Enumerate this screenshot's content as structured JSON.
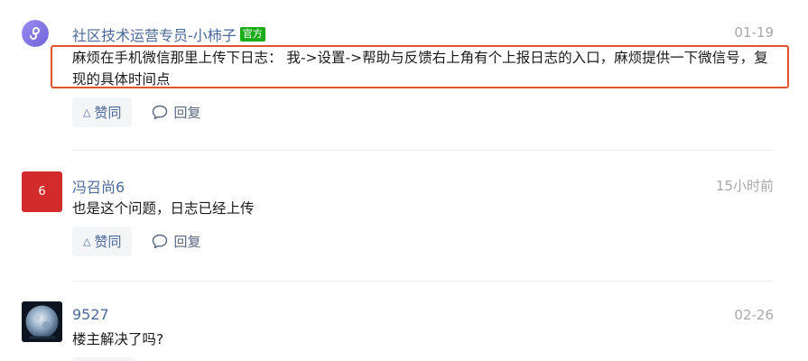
{
  "comments": [
    {
      "author": "社区技术运营专员-小柿子",
      "badge": "官方",
      "time": "01-19",
      "content": "麻烦在手机微信那里上传下日志： 我->设置->帮助与反馈右上角有个上报日志的入口，麻烦提供一下微信号，复现的具体时间点",
      "like_label": "赞同",
      "reply_label": "回复",
      "avatar_icon": "mini-program-icon"
    },
    {
      "author": "冯召尚6",
      "time": "15小时前",
      "content": "也是这个问题，日志已经上传",
      "like_label": "赞同",
      "reply_label": "回复",
      "avatar_text": "6"
    },
    {
      "author": "9527",
      "time": "02-26",
      "content": "楼主解决了吗?",
      "avatar_icon": "moon-photo-icon"
    }
  ],
  "colors": {
    "link": "#4b6a9b",
    "official_badge": "#1aad19",
    "highlight_border": "#e0542d",
    "avatar_red": "#d32b2b"
  }
}
